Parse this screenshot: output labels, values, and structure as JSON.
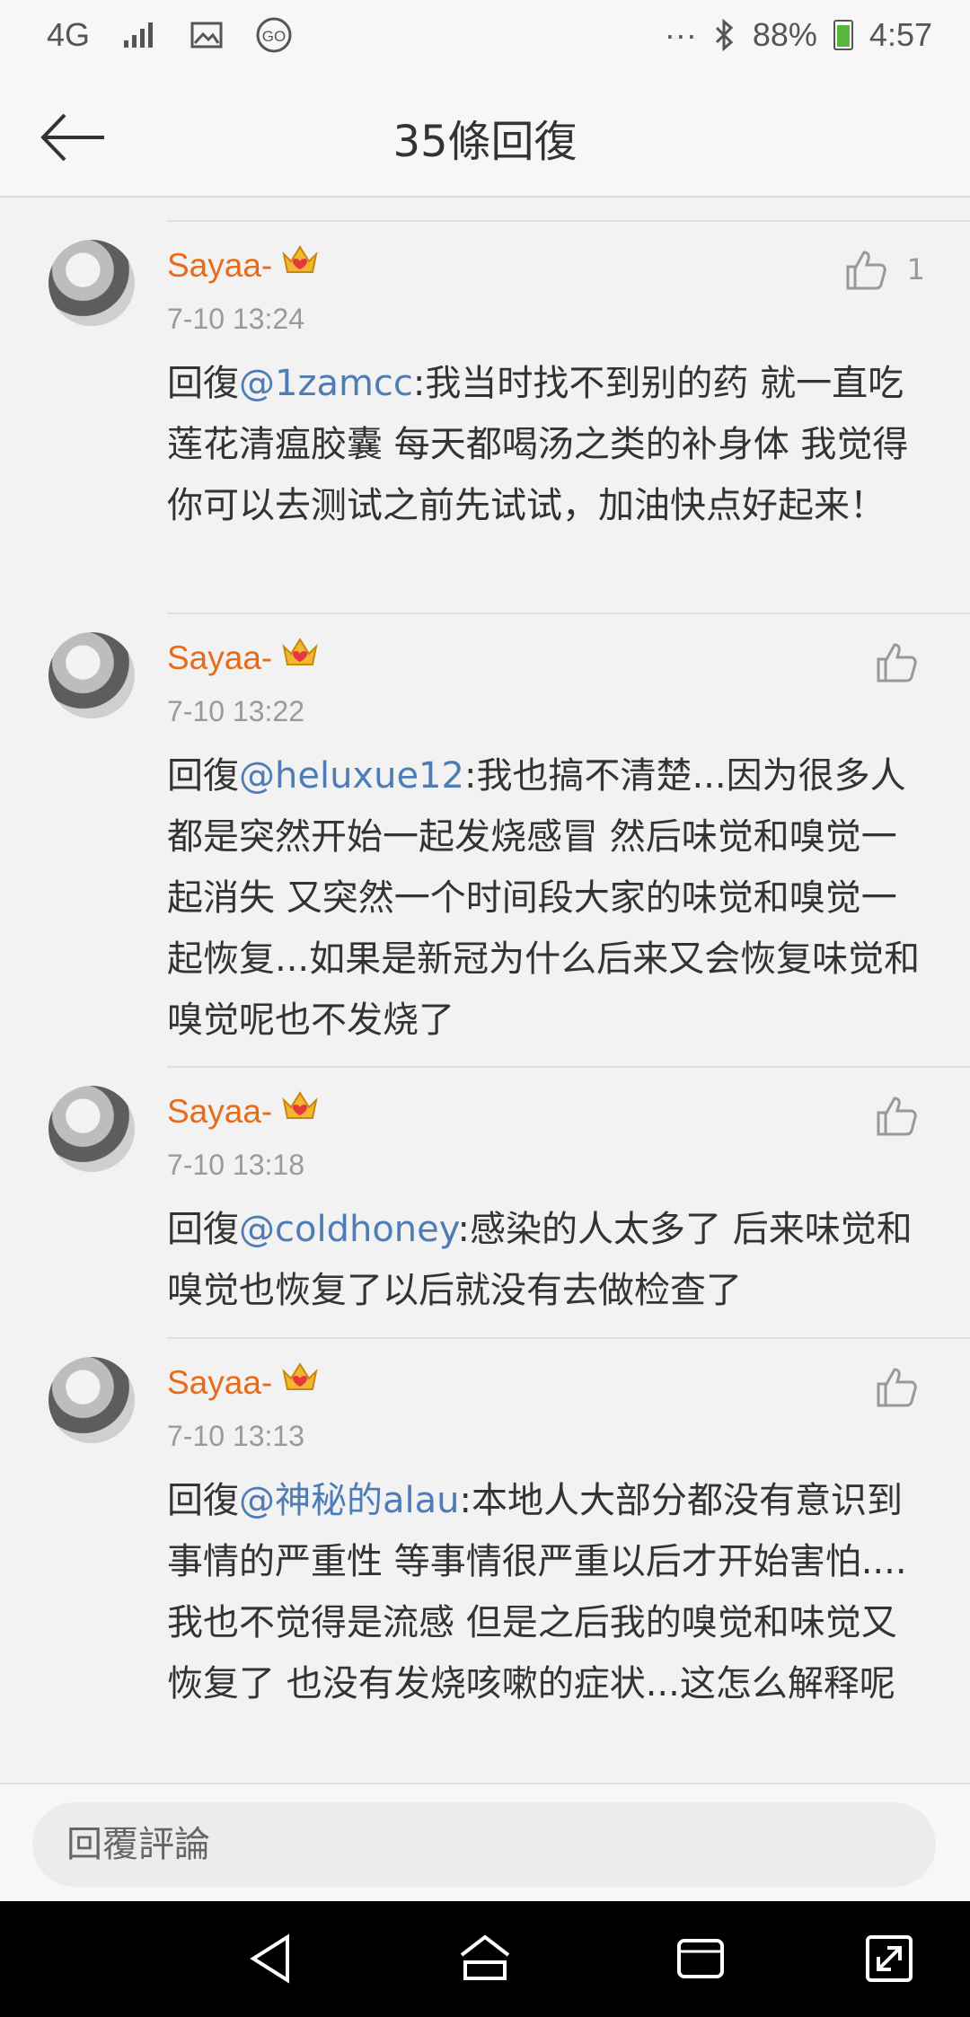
{
  "status_bar": {
    "network": "4G",
    "bluetooth_icon": "bluetooth-icon",
    "battery_percent": "88%",
    "time": "4:57",
    "more": "···"
  },
  "header": {
    "title": "35條回復"
  },
  "comments": [
    {
      "user": "Sayaa-",
      "time": "7-10 13:24",
      "like_count": "1",
      "reply_prefix": "回復",
      "mention": "@1zamcc",
      "content": ":我当时找不到别的药 就一直吃莲花清瘟胶囊 每天都喝汤之类的补身体 我觉得你可以去测试之前先试试，加油快点好起来！"
    },
    {
      "user": "Sayaa-",
      "time": "7-10 13:22",
      "like_count": "",
      "reply_prefix": "回復",
      "mention": "@heluxue12",
      "content": ":我也搞不清楚...因为很多人都是突然开始一起发烧感冒 然后味觉和嗅觉一起消失 又突然一个时间段大家的味觉和嗅觉一起恢复...如果是新冠为什么后来又会恢复味觉和嗅觉呢也不发烧了"
    },
    {
      "user": "Sayaa-",
      "time": "7-10 13:18",
      "like_count": "",
      "reply_prefix": "回復",
      "mention": "@coldhoney",
      "content": ":感染的人太多了 后来味觉和嗅觉也恢复了以后就没有去做检查了"
    },
    {
      "user": "Sayaa-",
      "time": "7-10 13:13",
      "like_count": "",
      "reply_prefix": "回復",
      "mention": "@神秘的alau",
      "content": ":本地人大部分都没有意识到事情的严重性 等事情很严重以后才开始害怕....我也不觉得是流感 但是之后我的嗅觉和味觉又恢复了 也没有发烧咳嗽的症状...这怎么解释呢"
    }
  ],
  "input": {
    "placeholder": "回覆評論"
  },
  "colors": {
    "username": "#e86b1a",
    "mention": "#4e7db5",
    "meta": "#9a9a9a"
  }
}
